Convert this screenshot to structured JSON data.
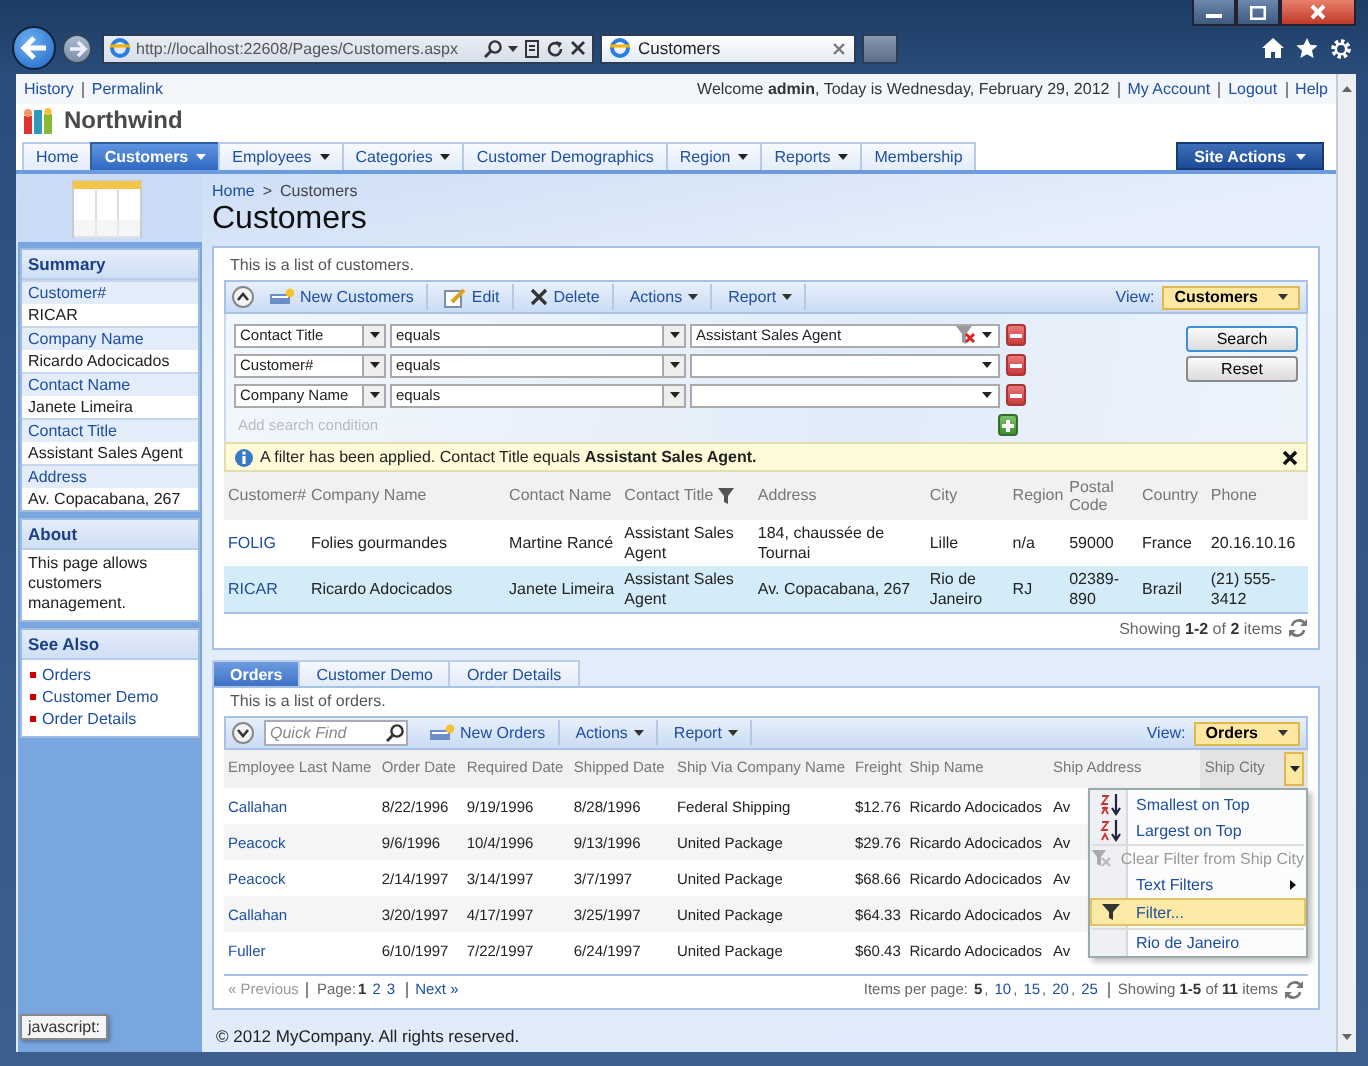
{
  "browser": {
    "address": "http://localhost:22608/Pages/Customers.aspx",
    "tab_title": "Customers"
  },
  "top_bar": {
    "left_links": [
      "History",
      "Permalink"
    ],
    "welcome": "Welcome **admin**, Today is Wednesday, February 29, 2012",
    "right_links": [
      "My Account",
      "Logout",
      "Help"
    ]
  },
  "brand": "Northwind",
  "menu": {
    "items": [
      {
        "label": "Home",
        "has_dropdown": false,
        "selected": false
      },
      {
        "label": "Customers",
        "has_dropdown": true,
        "selected": true
      },
      {
        "label": "Employees",
        "has_dropdown": true,
        "selected": false
      },
      {
        "label": "Categories",
        "has_dropdown": true,
        "selected": false
      },
      {
        "label": "Customer Demographics",
        "has_dropdown": false,
        "selected": false
      },
      {
        "label": "Region",
        "has_dropdown": true,
        "selected": false
      },
      {
        "label": "Reports",
        "has_dropdown": true,
        "selected": false
      },
      {
        "label": "Membership",
        "has_dropdown": false,
        "selected": false
      }
    ],
    "site_actions": "Site Actions"
  },
  "breadcrumb": {
    "items": [
      "Home",
      "Customers"
    ],
    "separator": ">"
  },
  "page_title": "Customers",
  "sidebar": {
    "summary": {
      "title": "Summary",
      "fields": [
        {
          "label": "Customer#",
          "value": "RICAR"
        },
        {
          "label": "Company Name",
          "value": "Ricardo Adocicados"
        },
        {
          "label": "Contact Name",
          "value": "Janete Limeira"
        },
        {
          "label": "Contact Title",
          "value": "Assistant Sales Agent"
        },
        {
          "label": "Address",
          "value": "Av. Copacabana, 267"
        }
      ]
    },
    "about": {
      "title": "About",
      "text": "This page allows customers management."
    },
    "see_also": {
      "title": "See Also",
      "links": [
        "Orders",
        "Customer Demo",
        "Order Details"
      ]
    }
  },
  "customers": {
    "description": "This is a list of customers.",
    "search_expanded": true,
    "toolbar": [
      {
        "label": "New Customers",
        "kind": "new"
      },
      {
        "label": "Edit",
        "kind": "edit"
      },
      {
        "label": "Delete",
        "kind": "delete"
      },
      {
        "label": "Actions",
        "kind": "menu"
      },
      {
        "label": "Report",
        "kind": "menu"
      }
    ],
    "view_label": "View:",
    "view": "Customers",
    "search": {
      "conditions": [
        {
          "field": "Contact Title",
          "operator": "equals",
          "value": "Assistant Sales Agent",
          "filtered": true
        },
        {
          "field": "Customer#",
          "operator": "equals",
          "filtered": false
        },
        {
          "field": "Company Name",
          "operator": "equals",
          "filtered": false
        }
      ],
      "add_placeholder": "Add search condition",
      "buttons": [
        "Search",
        "Reset"
      ]
    },
    "filter_notice": "A filter has been applied. Contact Title equals **Assistant Sales Agent.**",
    "columns": [
      {
        "label": "Customer#",
        "filtered": false
      },
      {
        "label": "Company Name",
        "filtered": false
      },
      {
        "label": "Contact Name",
        "filtered": false
      },
      {
        "label": "Contact Title",
        "filtered": true
      },
      {
        "label": "Address",
        "filtered": false
      },
      {
        "label": "City",
        "filtered": false
      },
      {
        "label": "Region",
        "filtered": false
      },
      {
        "label": "Postal Code",
        "filtered": false
      },
      {
        "label": "Country",
        "filtered": false
      },
      {
        "label": "Phone",
        "filtered": false
      }
    ],
    "rows": [
      {
        "selected": false,
        "cells": [
          "FOLIG",
          "Folies gourmandes",
          "Martine Rancé",
          "Assistant Sales Agent",
          "184, chaussée de Tournai",
          "Lille",
          "n/a",
          "59000",
          "France",
          "20.16.10.16"
        ]
      },
      {
        "selected": true,
        "cells": [
          "RICAR",
          "Ricardo Adocicados",
          "Janete Limeira",
          "Assistant Sales Agent",
          "Av. Copacabana, 267",
          "Rio de Janeiro",
          "RJ",
          "02389-890",
          "Brazil",
          "(21) 555-3412"
        ]
      }
    ],
    "status": "Showing **1-2** of **2** items"
  },
  "orders": {
    "tabs": [
      {
        "label": "Orders",
        "selected": true
      },
      {
        "label": "Customer Demo",
        "selected": false
      },
      {
        "label": "Order Details",
        "selected": false
      }
    ],
    "description": "This is a list of orders.",
    "search_expanded": false,
    "quick_find_placeholder": "Quick Find",
    "toolbar": [
      {
        "label": "New Orders",
        "kind": "new"
      },
      {
        "label": "Actions",
        "kind": "menu"
      },
      {
        "label": "Report",
        "kind": "menu"
      }
    ],
    "view_label": "View:",
    "view": "Orders",
    "columns": [
      {
        "label": "Employee Last Name",
        "active": false
      },
      {
        "label": "Order Date",
        "active": false
      },
      {
        "label": "Required Date",
        "active": false
      },
      {
        "label": "Shipped Date",
        "active": false
      },
      {
        "label": "Ship Via Company Name",
        "active": false
      },
      {
        "label": "Freight",
        "active": false
      },
      {
        "label": "Ship Name",
        "active": false
      },
      {
        "label": "Ship Address",
        "active": false
      },
      {
        "label": "Ship City",
        "active": true
      }
    ],
    "rows": [
      {
        "cells": [
          "Callahan",
          "8/22/1996",
          "9/19/1996",
          "8/28/1996",
          "Federal Shipping",
          "$12.76",
          "Ricardo Adocicados",
          "Av"
        ]
      },
      {
        "cells": [
          "Peacock",
          "9/6/1996",
          "10/4/1996",
          "9/13/1996",
          "United Package",
          "$29.76",
          "Ricardo Adocicados",
          "Av"
        ]
      },
      {
        "cells": [
          "Peacock",
          "2/14/1997",
          "3/14/1997",
          "3/7/1997",
          "United Package",
          "$68.66",
          "Ricardo Adocicados",
          "Av"
        ]
      },
      {
        "cells": [
          "Callahan",
          "3/20/1997",
          "4/17/1997",
          "3/25/1997",
          "United Package",
          "$64.33",
          "Ricardo Adocicados",
          "Av"
        ]
      },
      {
        "cells": [
          "Fuller",
          "6/10/1997",
          "7/22/1997",
          "6/24/1997",
          "United Package",
          "$60.43",
          "Ricardo Adocicados",
          "Av"
        ]
      }
    ],
    "column_menu": [
      {
        "label": "Smallest on Top",
        "kind": "sort-asc",
        "disabled": false,
        "highlighted": false,
        "submenu": false,
        "separator_before": false
      },
      {
        "label": "Largest on Top",
        "kind": "sort-desc",
        "disabled": false,
        "highlighted": false,
        "submenu": false,
        "separator_before": false
      },
      {
        "label": "Clear Filter from Ship City",
        "kind": "clear-filter",
        "disabled": true,
        "highlighted": false,
        "submenu": false,
        "separator_before": true
      },
      {
        "label": "Text Filters",
        "kind": "plain",
        "disabled": false,
        "highlighted": false,
        "submenu": true,
        "separator_before": false
      },
      {
        "label": "Filter...",
        "kind": "filter",
        "disabled": false,
        "highlighted": true,
        "submenu": false,
        "separator_before": false
      },
      {
        "label": "Rio de Janeiro",
        "kind": "plain",
        "disabled": false,
        "highlighted": false,
        "submenu": false,
        "separator_before": true
      }
    ],
    "pager": {
      "previous": "« Previous",
      "page_label": "Page:",
      "pages": [
        {
          "label": "1",
          "selected": true
        },
        {
          "label": "2",
          "selected": false
        },
        {
          "label": "3",
          "selected": false
        }
      ],
      "next": "Next »",
      "per_page_label": "Items per page:",
      "per_page": [
        {
          "label": "5",
          "selected": true
        },
        {
          "label": "10",
          "selected": false
        },
        {
          "label": "15",
          "selected": false
        },
        {
          "label": "20",
          "selected": false
        },
        {
          "label": "25",
          "selected": false
        }
      ],
      "list_separator": ",",
      "status": "Showing **1-5** of **11** items"
    }
  },
  "footer": "© 2012 MyCompany. All rights reserved.",
  "status_tip": "javascript:"
}
